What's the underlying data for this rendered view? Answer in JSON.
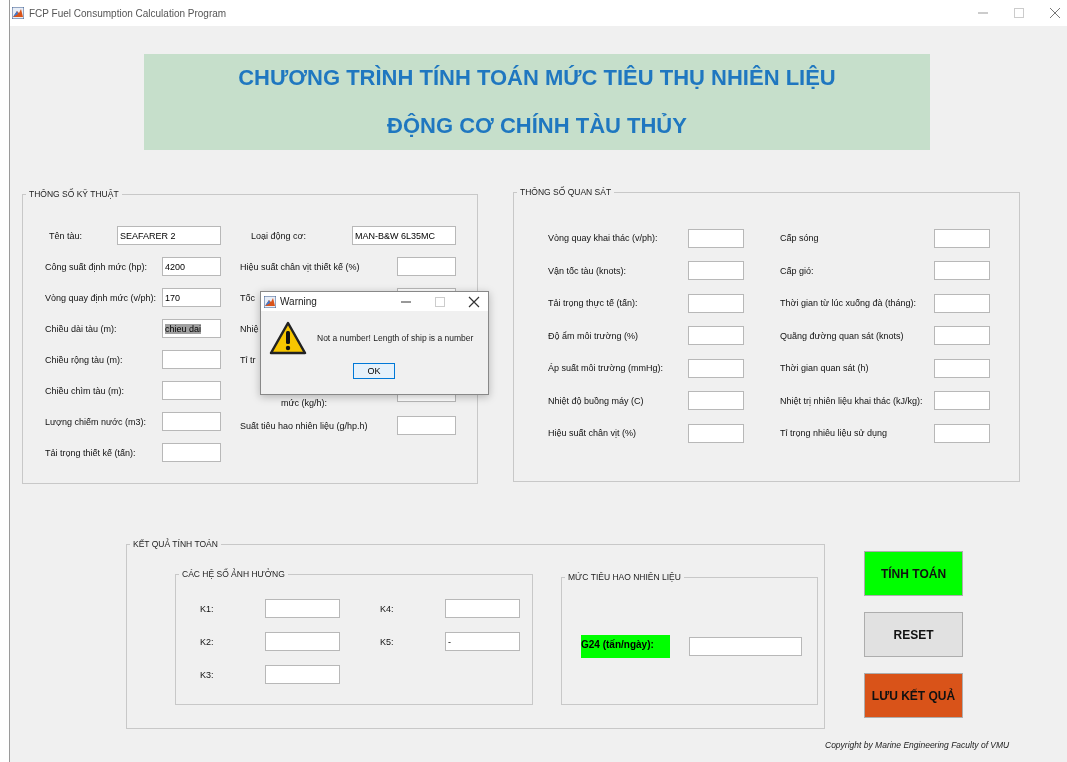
{
  "window": {
    "title": "FCP Fuel Consumption Calculation Program"
  },
  "banner": {
    "lines": [
      "CHƯƠNG TRÌNH TÍNH TOÁN MỨC TIÊU THỤ NHIÊN LIỆU",
      "ĐỘNG CƠ CHÍNH TÀU THỦY"
    ]
  },
  "technical": {
    "title": "THÔNG SỐ KỸ THUẬT",
    "columns": [
      [
        {
          "label": "Tên tàu:",
          "kind": "input",
          "value": "SEAFARER 2"
        },
        {
          "label": "Công suất định mức (hp):",
          "kind": "input",
          "value": "4200"
        },
        {
          "label": "Vòng quay định mức (v/ph):",
          "kind": "input",
          "value": "170"
        },
        {
          "label": "Chiều dài tàu (m):",
          "kind": "input",
          "value": "chieu dai",
          "highlighted": true
        },
        {
          "label": "Chiều rộng tàu (m):",
          "kind": "input"
        },
        {
          "label": "Chiều chìm tàu (m):",
          "kind": "input"
        },
        {
          "label": "Lượng chiếm nước (m3):",
          "kind": "input"
        },
        {
          "label": "Tải trọng thiết kế (tấn):",
          "kind": "input"
        }
      ],
      [
        {
          "label": "Loại động cơ:",
          "kind": "input",
          "value": "MAN-B&W 6L35MC"
        },
        {
          "label": "Hiệu suất chân vịt thiết kế (%)",
          "kind": "input"
        },
        {
          "label": "Tốc",
          "kind": "input"
        },
        {
          "label": "Nhiệ",
          "kind": "label_only"
        },
        {
          "label": "Tỉ tr",
          "kind": "label_only"
        },
        {
          "label": "mức (kg/h):",
          "kind": "input"
        },
        {
          "label": "Suất tiêu hao nhiên liệu (g/hp.h)",
          "kind": "input"
        }
      ]
    ]
  },
  "observed": {
    "title": "THÔNG SỐ QUAN SÁT",
    "columns": [
      [
        {
          "label": "Vòng quay khai thác (v/ph):",
          "kind": "input"
        },
        {
          "label": "Vận tốc tàu (knots):",
          "kind": "input"
        },
        {
          "label": "Tải trọng thực tế (tấn):",
          "kind": "input"
        },
        {
          "label": "Độ ẩm môi trường (%)",
          "kind": "input"
        },
        {
          "label": "Áp suất môi trường (mmHg):",
          "kind": "input"
        },
        {
          "label": "Nhiệt độ buồng máy (C)",
          "kind": "input"
        },
        {
          "label": "Hiệu suất chân vịt (%)",
          "kind": "input"
        }
      ],
      [
        {
          "label": "Cấp sóng",
          "kind": "input"
        },
        {
          "label": "Cấp gió:",
          "kind": "input"
        },
        {
          "label": "Thời gian từ lúc xuống đà (tháng):",
          "kind": "input"
        },
        {
          "label": "Quãng đường quan sát (knots)",
          "kind": "input"
        },
        {
          "label": "Thời gian quan sát (h)",
          "kind": "input"
        },
        {
          "label": "Nhiệt trị nhiên liệu khai thác (kJ/kg):",
          "kind": "input"
        },
        {
          "label": "Tỉ trọng nhiêu liệu sử dụng",
          "kind": "input"
        }
      ]
    ]
  },
  "results": {
    "title": "KẾT QUẢ TÍNH TOÁN",
    "coefficients": {
      "title": "CÁC HỆ SỐ ẢNH HƯỞNG",
      "columns": [
        [
          {
            "label": "K1:",
            "kind": "input"
          },
          {
            "label": "K2:",
            "kind": "input"
          },
          {
            "label": "K3:",
            "kind": "input"
          }
        ],
        [
          {
            "label": "K4:",
            "kind": "input"
          },
          {
            "label": "K5:",
            "kind": "input",
            "value": "-"
          }
        ]
      ]
    },
    "consumption": {
      "title": "MỨC TIÊU HAO NHIÊN LIỆU",
      "label": "G24 (tấn/ngày):"
    }
  },
  "buttons": [
    {
      "label": "TÍNH TOÁN",
      "color": "#00ff00"
    },
    {
      "label": "RESET",
      "color": "#e1e1e1"
    },
    {
      "label": "LƯU KẾT QUẢ",
      "color": "#d95319"
    }
  ],
  "copyright": "Copyright by Marine Engineering Faculty of VMU",
  "dialog": {
    "title": "Warning",
    "message": "Not a number! Length of ship is a number",
    "button": "OK"
  }
}
